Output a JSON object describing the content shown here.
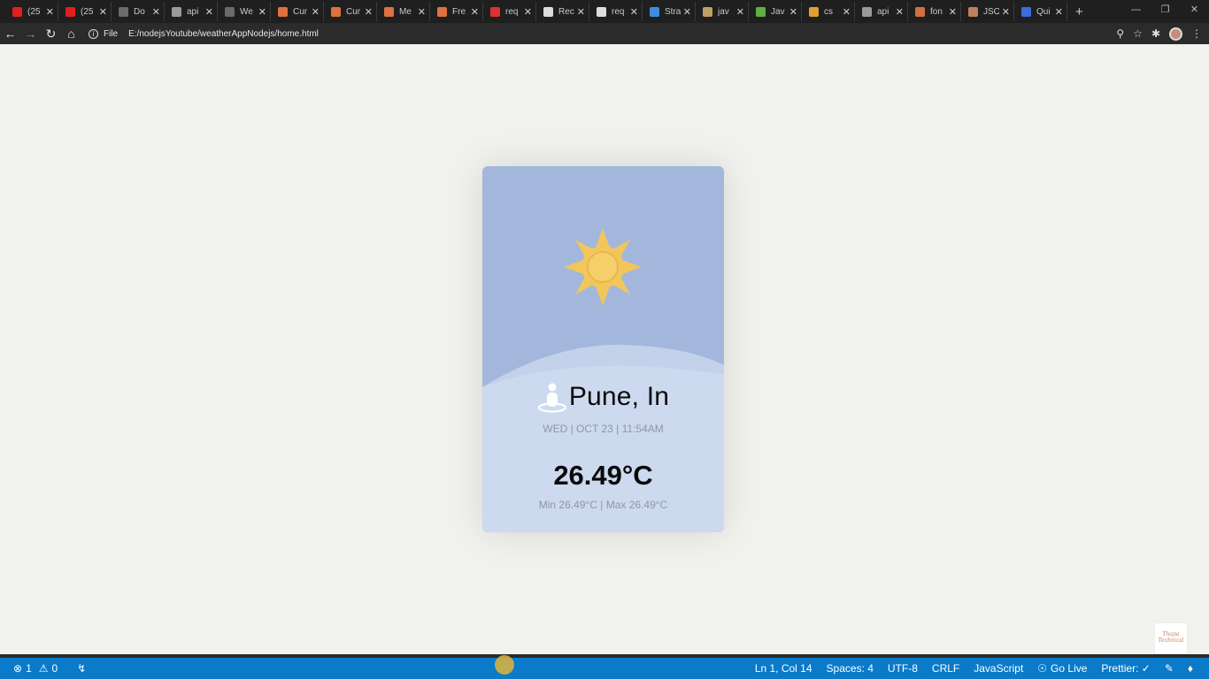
{
  "browser": {
    "tabs": [
      {
        "label": "(25",
        "favicon_color": "#e02020"
      },
      {
        "label": "(25",
        "favicon_color": "#e02020"
      },
      {
        "label": "Do",
        "favicon_color": "#6b6b6b"
      },
      {
        "label": "api",
        "favicon_color": "#9a9a9a"
      },
      {
        "label": "We",
        "favicon_color": "#6b6b6b"
      },
      {
        "label": "Cur",
        "favicon_color": "#e07040"
      },
      {
        "label": "Cur",
        "favicon_color": "#e07040"
      },
      {
        "label": "Me",
        "favicon_color": "#e07040"
      },
      {
        "label": "Fre",
        "favicon_color": "#e07040"
      },
      {
        "label": "req",
        "favicon_color": "#e03030"
      },
      {
        "label": "Rec",
        "favicon_color": "#dddddd"
      },
      {
        "label": "req",
        "favicon_color": "#dddddd"
      },
      {
        "label": "Stra",
        "favicon_color": "#3a8ee0"
      },
      {
        "label": "jav",
        "favicon_color": "#c0a060"
      },
      {
        "label": "Jav",
        "favicon_color": "#60b040"
      },
      {
        "label": "cs",
        "favicon_color": "#e0a030"
      },
      {
        "label": "api",
        "favicon_color": "#9a9a9a"
      },
      {
        "label": "fon",
        "favicon_color": "#d07040"
      },
      {
        "label": "JSO",
        "favicon_color": "#c08060"
      },
      {
        "label": "Qui",
        "favicon_color": "#3a6ee0"
      }
    ],
    "new_tab_symbol": "+",
    "scheme_label": "File",
    "url": "E:/nodejsYoutube/weatherAppNodejs/home.html"
  },
  "card": {
    "city": "Pune, In",
    "datetime": "WED | OCT 23 | 11:54AM",
    "temperature": "26.49°C",
    "minmax": "Min 26.49°C | Max 26.49°C",
    "sun_color": "#f2c65a",
    "sky_color": "#a2b7db",
    "ground_color": "#cdd9ee"
  },
  "statusbar": {
    "errors": "1",
    "warnings": "0",
    "position": "Ln 1, Col 14",
    "spaces": "Spaces: 4",
    "encoding": "UTF-8",
    "eol": "CRLF",
    "language": "JavaScript",
    "go_live": "Go Live",
    "prettier": "Prettier: ✓"
  }
}
